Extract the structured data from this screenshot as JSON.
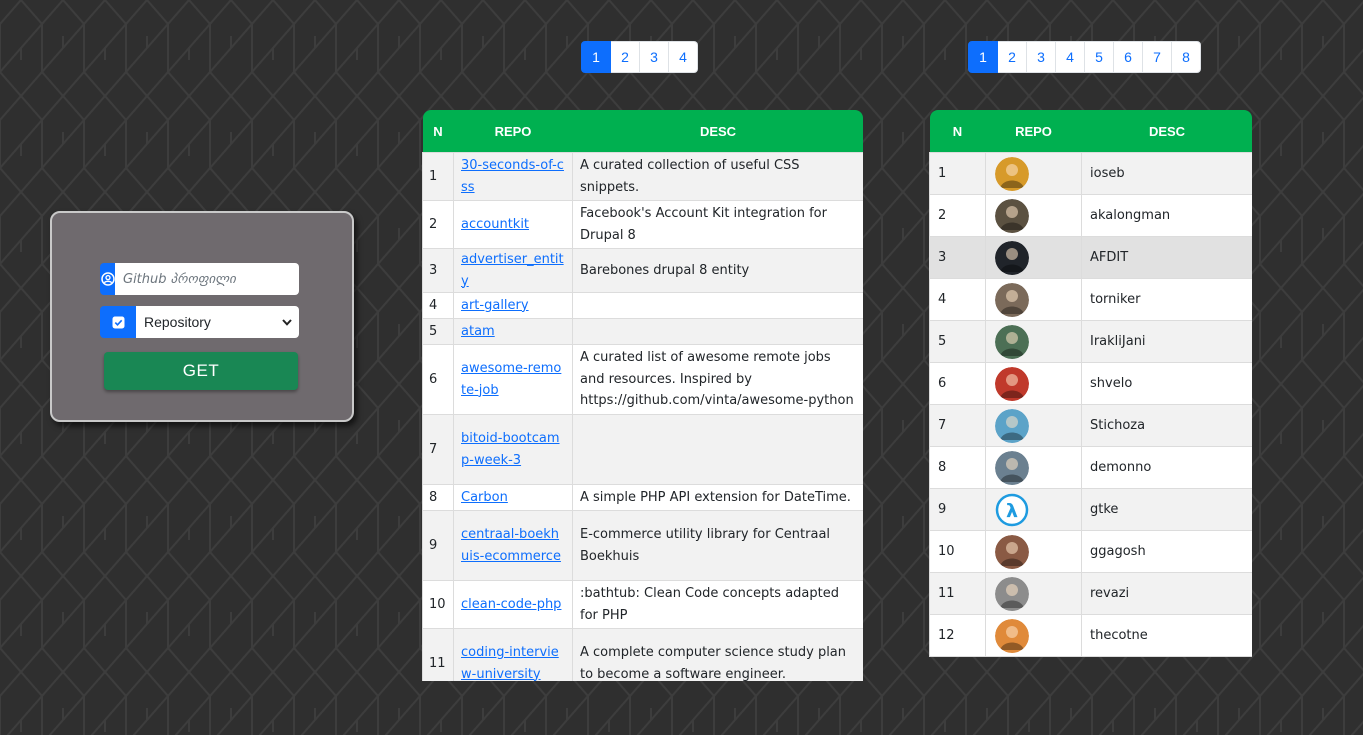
{
  "search": {
    "placeholder": "Github პროფილი",
    "select_value": "Repository",
    "get_label": "GET",
    "accent_color": "#0d6efd",
    "button_color": "#198754",
    "icons": [
      "user-circle-icon",
      "checkbox-icon"
    ]
  },
  "repo_pagination": [
    "1",
    "2",
    "3",
    "4"
  ],
  "user_pagination": [
    "1",
    "2",
    "3",
    "4",
    "5",
    "6",
    "7",
    "8"
  ],
  "repo_table": {
    "headers": [
      "N",
      "REPO",
      "DESC"
    ],
    "header_color": "#00b050",
    "rows": [
      {
        "n": "1",
        "repo": "30-seconds-of-css",
        "desc": "A curated collection of useful CSS snippets."
      },
      {
        "n": "2",
        "repo": "accountkit",
        "desc": "Facebook's Account Kit integration for Drupal 8"
      },
      {
        "n": "3",
        "repo": "advertiser_entity",
        "desc": "Barebones drupal 8 entity"
      },
      {
        "n": "4",
        "repo": "art-gallery",
        "desc": ""
      },
      {
        "n": "5",
        "repo": "atam",
        "desc": ""
      },
      {
        "n": "6",
        "repo": "awesome-remote-job",
        "desc": "A curated list of awesome remote jobs and resources. Inspired by https://github.com/vinta/awesome-python"
      },
      {
        "n": "7",
        "repo": "bitoid-bootcamp-week-3",
        "desc": ""
      },
      {
        "n": "8",
        "repo": "Carbon",
        "desc": "A simple PHP API extension for DateTime."
      },
      {
        "n": "9",
        "repo": "centraal-boekhuis-ecommerce",
        "desc": "E-commerce utility library for Centraal Boekhuis"
      },
      {
        "n": "10",
        "repo": "clean-code-php",
        "desc": ":bathtub: Clean Code concepts adapted for PHP"
      },
      {
        "n": "11",
        "repo": "coding-interview-university",
        "desc": "A complete computer science study plan to become a software engineer."
      }
    ]
  },
  "user_table": {
    "headers": [
      "N",
      "REPO",
      "DESC"
    ],
    "header_color": "#00b050",
    "rows": [
      {
        "n": "1",
        "name": "ioseb",
        "avatar_color": "#d79a2a"
      },
      {
        "n": "2",
        "name": "akalongman",
        "avatar_color": "#5b5141"
      },
      {
        "n": "3",
        "name": "AFDIT",
        "avatar_color": "#20242a"
      },
      {
        "n": "4",
        "name": "torniker",
        "avatar_color": "#7b6a5a"
      },
      {
        "n": "5",
        "name": "IrakliJani",
        "avatar_color": "#4c6f55"
      },
      {
        "n": "6",
        "name": "shvelo",
        "avatar_color": "#c0392b"
      },
      {
        "n": "7",
        "name": "Stichoza",
        "avatar_color": "#5ca3c8"
      },
      {
        "n": "8",
        "name": "demonno",
        "avatar_color": "#6b8090"
      },
      {
        "n": "9",
        "name": "gtke",
        "avatar_color": "#1e9be0"
      },
      {
        "n": "10",
        "name": "ggagosh",
        "avatar_color": "#8a5a44"
      },
      {
        "n": "11",
        "name": "revazi",
        "avatar_color": "#8c8c8c"
      },
      {
        "n": "12",
        "name": "thecotne",
        "avatar_color": "#e08a3a"
      }
    ]
  }
}
